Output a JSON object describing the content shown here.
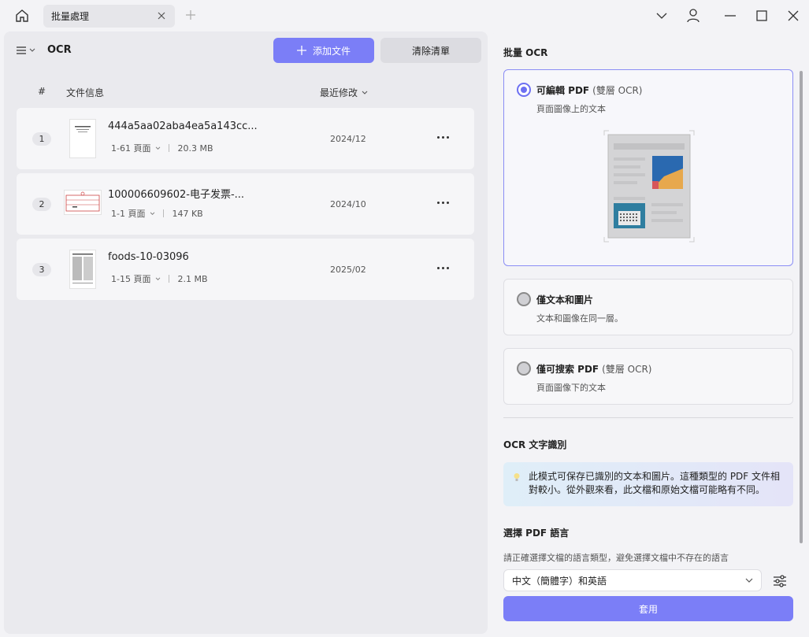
{
  "titlebar": {
    "tab_label": "批量處理"
  },
  "left": {
    "title": "OCR",
    "add_label": "添加文件",
    "clear_label": "清除清單",
    "columns": {
      "index": "#",
      "info": "文件信息",
      "modified": "最近修改"
    },
    "files": [
      {
        "index": "1",
        "name": "444a5aa02aba4ea5a143cc...",
        "pages": "1-61 頁面",
        "size": "20.3 MB",
        "date": "2024/12"
      },
      {
        "index": "2",
        "name": "100006609602-电子发票-...",
        "pages": "1-1 頁面",
        "size": "147 KB",
        "date": "2024/10"
      },
      {
        "index": "3",
        "name": "foods-10-03096",
        "pages": "1-15 頁面",
        "size": "2.1 MB",
        "date": "2025/02"
      }
    ]
  },
  "right": {
    "batch_heading": "批量 OCR",
    "options": [
      {
        "title": "可編輯 PDF",
        "sub": "(雙層 OCR)",
        "desc": "頁面圖像上的文本",
        "selected": true
      },
      {
        "title": "僅文本和圖片",
        "sub": "",
        "desc": "文本和圖像在同一層。",
        "selected": false
      },
      {
        "title": "僅可搜索 PDF",
        "sub": "(雙層 OCR)",
        "desc": "頁面圖像下的文本",
        "selected": false
      }
    ],
    "ocr_heading": "OCR 文字識別",
    "info_text": "此模式可保存已識別的文本和圖片。這種類型的 PDF 文件相對較小。從外觀來看，此文檔和原始文檔可能略有不同。",
    "lang_heading": "選擇 PDF 語言",
    "lang_hint": "請正確選擇文檔的語言類型，避免選擇文檔中不存在的語言",
    "lang_value": "中文（簡體字）和英語",
    "apply_label": "套用"
  },
  "colors": {
    "accent": "#7b7ef7",
    "panel": "#eaeaee",
    "selected_border": "#8b8ef5"
  }
}
